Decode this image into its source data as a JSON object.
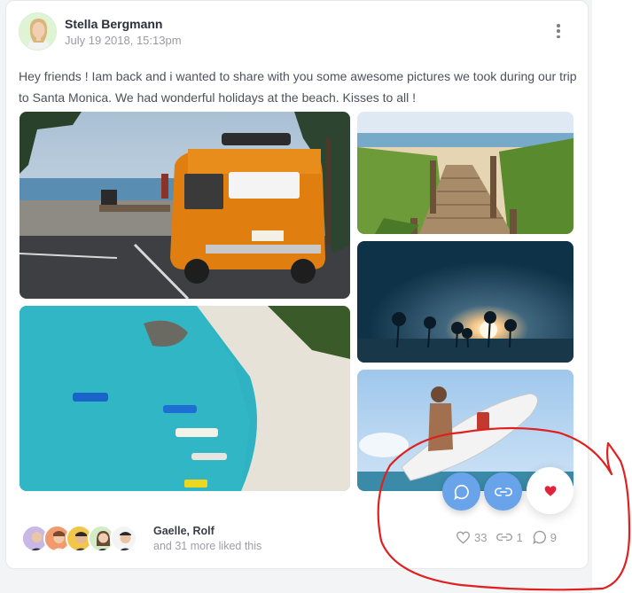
{
  "post": {
    "author": "Stella Bergmann",
    "date": "July 19 2018, 15:13pm",
    "text": "Hey friends ! Iam back and i wanted to share with you some awesome pictures we took during our trip to Santa Monica. We had wonderful holidays at the beach. Kisses to all !"
  },
  "likes": {
    "names": "Gaelle, Rolf",
    "more": "and 31 more liked this"
  },
  "stats": {
    "likes": "33",
    "shares": "1",
    "comments": "9"
  },
  "icons": {
    "menu": "more-vertical-icon",
    "like": "heart-icon",
    "share": "link-icon",
    "comment": "comment-icon"
  },
  "colors": {
    "accent": "#69a4ea",
    "heart": "#e0243b",
    "annotation": "#e0201e"
  }
}
